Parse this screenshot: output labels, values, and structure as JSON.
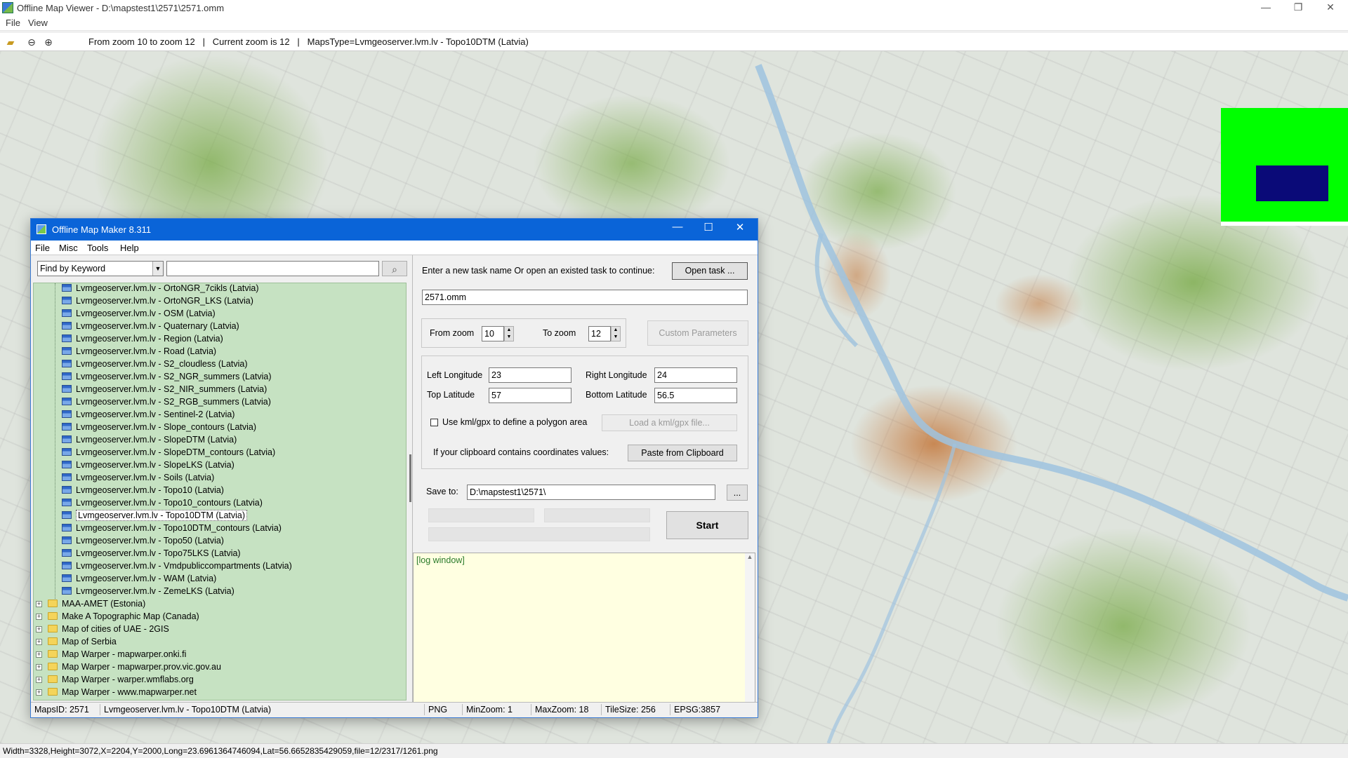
{
  "window": {
    "title": "Offline Map Viewer - D:\\mapstest1\\2571\\2571.omm",
    "minimize": "—",
    "maximize": "❐",
    "close": "✕"
  },
  "menubar": {
    "file": "File",
    "view": "View"
  },
  "toolbar": {
    "status": "From zoom 10 to zoom 12   |   Current zoom is 12   |   MapsType=Lvmgeoserver.lvm.lv - Topo10DTM (Latvia)"
  },
  "statusbar": {
    "text": "Width=3328,Height=3072,X=2204,Y=2000,Long=23.6961364746094,Lat=56.6652835429059,file=12/2317/1261.png"
  },
  "dialog": {
    "title": "Offline Map Maker 8.311",
    "minimize": "—",
    "maximize": "☐",
    "close": "✕",
    "menu": {
      "file": "File",
      "misc": "Misc",
      "tools": "Tools",
      "help": "Help"
    },
    "search": {
      "mode": "Find by Keyword",
      "query": ""
    },
    "task": {
      "prompt": "Enter a new task name Or open an existed task to continue:",
      "open_label": "Open task ...",
      "name": "2571.omm"
    },
    "zoom": {
      "from_label": "From zoom",
      "from_value": "10",
      "to_label": "To zoom",
      "to_value": "12",
      "custom_label": "Custom Parameters"
    },
    "coords": {
      "left_lon_label": "Left Longitude",
      "left_lon": "23",
      "right_lon_label": "Right Longitude",
      "right_lon": "24",
      "top_lat_label": "Top Latitude",
      "top_lat": "57",
      "bottom_lat_label": "Bottom Latitude",
      "bottom_lat": "56.5",
      "kml_label": "Use kml/gpx to define a polygon area",
      "kml_button": "Load a kml/gpx file...",
      "clipboard_label": "If your clipboard contains coordinates values:",
      "clipboard_button": "Paste from Clipboard"
    },
    "save": {
      "label": "Save to:",
      "path": "D:\\mapstest1\\2571\\",
      "browse": "..."
    },
    "start_label": "Start",
    "log_text": "[log window]",
    "tree": {
      "items": [
        "Lvmgeoserver.lvm.lv - OrtoNGR_7cikls (Latvia)",
        "Lvmgeoserver.lvm.lv - OrtoNGR_LKS (Latvia)",
        "Lvmgeoserver.lvm.lv - OSM (Latvia)",
        "Lvmgeoserver.lvm.lv - Quaternary (Latvia)",
        "Lvmgeoserver.lvm.lv - Region (Latvia)",
        "Lvmgeoserver.lvm.lv - Road (Latvia)",
        "Lvmgeoserver.lvm.lv - S2_cloudless (Latvia)",
        "Lvmgeoserver.lvm.lv - S2_NGR_summers (Latvia)",
        "Lvmgeoserver.lvm.lv - S2_NIR_summers (Latvia)",
        "Lvmgeoserver.lvm.lv - S2_RGB_summers (Latvia)",
        "Lvmgeoserver.lvm.lv - Sentinel-2 (Latvia)",
        "Lvmgeoserver.lvm.lv - Slope_contours (Latvia)",
        "Lvmgeoserver.lvm.lv - SlopeDTM (Latvia)",
        "Lvmgeoserver.lvm.lv - SlopeDTM_contours (Latvia)",
        "Lvmgeoserver.lvm.lv - SlopeLKS (Latvia)",
        "Lvmgeoserver.lvm.lv - Soils (Latvia)",
        "Lvmgeoserver.lvm.lv - Topo10 (Latvia)",
        "Lvmgeoserver.lvm.lv - Topo10_contours (Latvia)",
        "Lvmgeoserver.lvm.lv - Topo10DTM (Latvia)",
        "Lvmgeoserver.lvm.lv - Topo10DTM_contours (Latvia)",
        "Lvmgeoserver.lvm.lv - Topo50 (Latvia)",
        "Lvmgeoserver.lvm.lv - Topo75LKS (Latvia)",
        "Lvmgeoserver.lvm.lv - Vmdpubliccompartments (Latvia)",
        "Lvmgeoserver.lvm.lv - WAM (Latvia)",
        "Lvmgeoserver.lvm.lv - ZemeLKS (Latvia)"
      ],
      "selected": "Lvmgeoserver.lvm.lv - Topo10DTM (Latvia)",
      "folders": [
        "MAA-AMET (Estonia)",
        "Make A Topographic Map (Canada)",
        "Map of cities of UAE - 2GIS",
        "Map of Serbia",
        "Map Warper - mapwarper.onki.fi",
        "Map Warper - mapwarper.prov.vic.gov.au",
        "Map Warper - warper.wmflabs.org",
        "Map Warper - www.mapwarper.net"
      ]
    },
    "status": {
      "maps_id": "MapsID: 2571",
      "maps_name": "Lvmgeoserver.lvm.lv - Topo10DTM (Latvia)",
      "format": "PNG",
      "min_zoom": "MinZoom: 1",
      "max_zoom": "MaxZoom: 18",
      "tile_size": "TileSize: 256",
      "epsg": "EPSG:3857"
    }
  },
  "colors": {
    "map_green": "#7fb350",
    "overview_bg": "#00ff00",
    "overview_view": "#0a0a78",
    "tree_bg": "#c6e2c2",
    "log_bg": "#ffffe1",
    "dialog_title": "#0a64d8"
  }
}
